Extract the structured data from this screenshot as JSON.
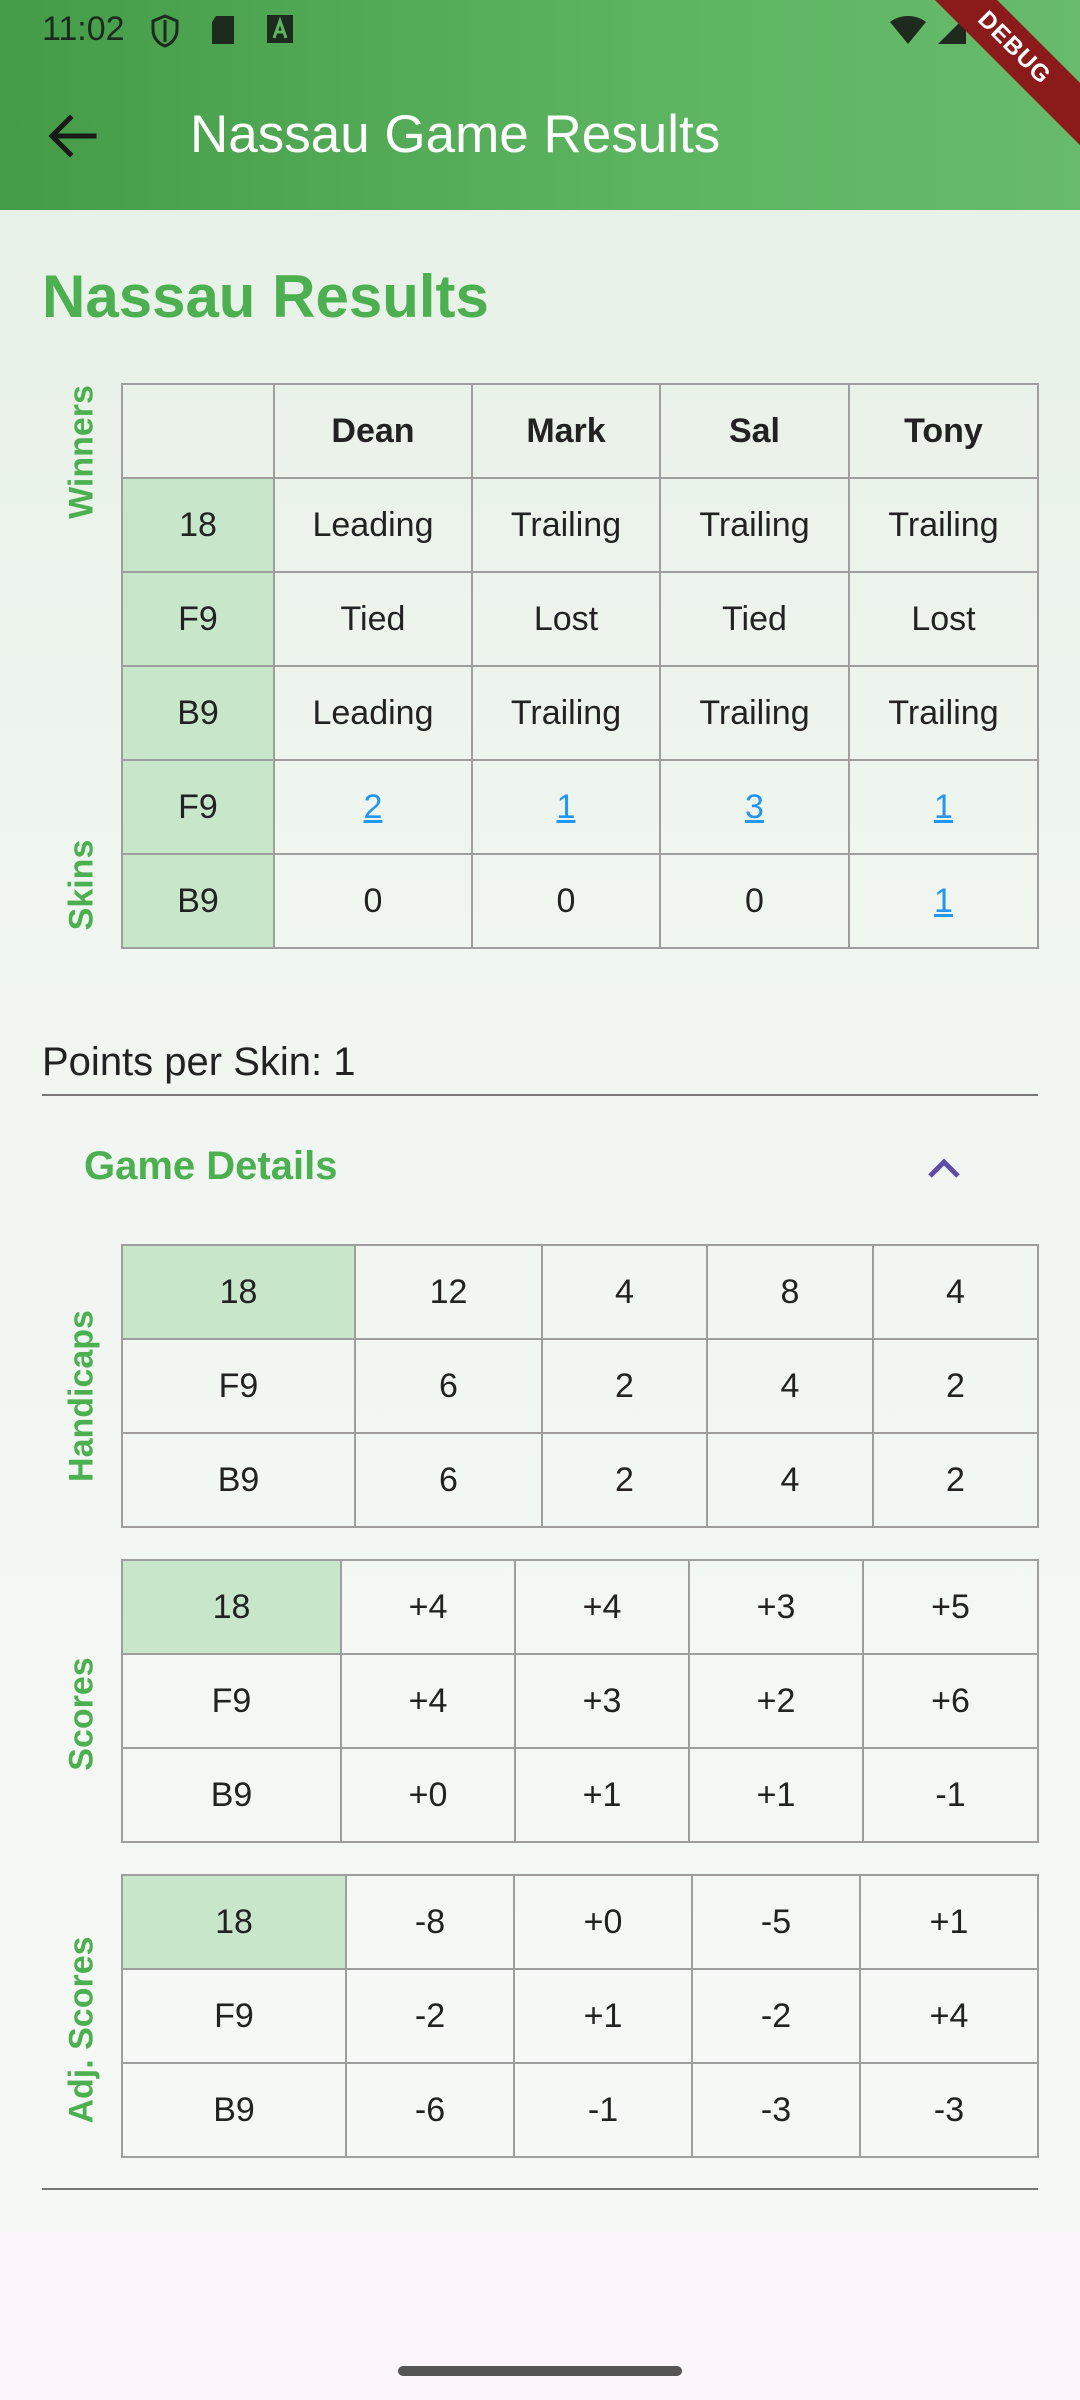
{
  "status_bar": {
    "time": "11:02"
  },
  "app_bar": {
    "title": "Nassau Game Results",
    "debug_banner": "DEBUG"
  },
  "page": {
    "heading": "Nassau Results"
  },
  "results": {
    "winners_label": "Winners",
    "skins_label": "Skins",
    "players": [
      "Dean",
      "Mark",
      "Sal",
      "Tony"
    ],
    "winners_rows": [
      {
        "label": "18",
        "values": [
          "Leading",
          "Trailing",
          "Trailing",
          "Trailing"
        ]
      },
      {
        "label": "F9",
        "values": [
          "Tied",
          "Lost",
          "Tied",
          "Lost"
        ]
      },
      {
        "label": "B9",
        "values": [
          "Leading",
          "Trailing",
          "Trailing",
          "Trailing"
        ]
      }
    ],
    "skins_rows": [
      {
        "label": "F9",
        "values": [
          "2",
          "1",
          "3",
          "1"
        ],
        "links": [
          true,
          true,
          true,
          true
        ]
      },
      {
        "label": "B9",
        "values": [
          "0",
          "0",
          "0",
          "1"
        ],
        "links": [
          false,
          false,
          false,
          true
        ]
      }
    ]
  },
  "points_per_skin": "Points per Skin: 1",
  "game_details": {
    "title": "Game Details",
    "expanded": true,
    "sections": [
      {
        "label": "Handicaps",
        "rows": [
          {
            "label": "18",
            "values": [
              "12",
              "4",
              "8",
              "4"
            ]
          },
          {
            "label": "F9",
            "values": [
              "6",
              "2",
              "4",
              "2"
            ]
          },
          {
            "label": "B9",
            "values": [
              "6",
              "2",
              "4",
              "2"
            ]
          }
        ]
      },
      {
        "label": "Scores",
        "rows": [
          {
            "label": "18",
            "values": [
              "+4",
              "+4",
              "+3",
              "+5"
            ]
          },
          {
            "label": "F9",
            "values": [
              "+4",
              "+3",
              "+2",
              "+6"
            ]
          },
          {
            "label": "B9",
            "values": [
              "+0",
              "+1",
              "+1",
              "-1"
            ]
          }
        ]
      },
      {
        "label": "Adj. Scores",
        "rows": [
          {
            "label": "18",
            "values": [
              "-8",
              "+0",
              "-5",
              "+1"
            ]
          },
          {
            "label": "F9",
            "values": [
              "-2",
              "+1",
              "-2",
              "+4"
            ]
          },
          {
            "label": "B9",
            "values": [
              "-6",
              "-1",
              "-3",
              "-3"
            ]
          }
        ]
      }
    ]
  },
  "colors": {
    "accent": "#4caf50",
    "header_cell": "#c8e6c9",
    "link": "#2196f3",
    "app_bar": "#56ad5a"
  }
}
